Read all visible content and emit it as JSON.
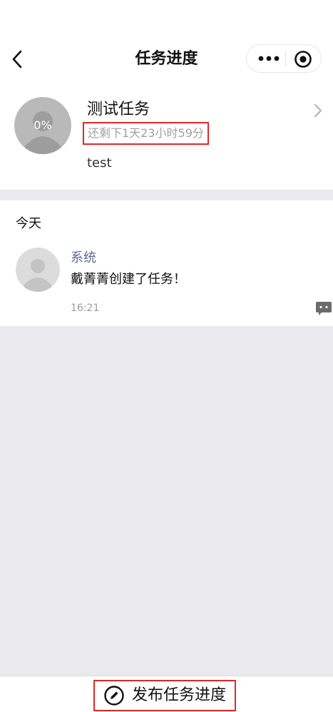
{
  "header": {
    "title": "任务进度",
    "back_icon": "back-arrow-icon",
    "more_icon": "more-dots-icon",
    "close_icon": "target-icon"
  },
  "task": {
    "progress_label": "0%",
    "name": "测试任务",
    "remaining": "还剩下1天23小时59分",
    "description": "test"
  },
  "timeline": {
    "day_label": "今天",
    "entries": [
      {
        "author": "系统",
        "text": "戴菁菁创建了任务！",
        "time": "16:21"
      }
    ]
  },
  "footer": {
    "publish_label": "发布任务进度"
  },
  "colors": {
    "accent_red": "#e0262b",
    "author_blue": "#5d6a8f",
    "background_gray": "#e9e9ee"
  }
}
